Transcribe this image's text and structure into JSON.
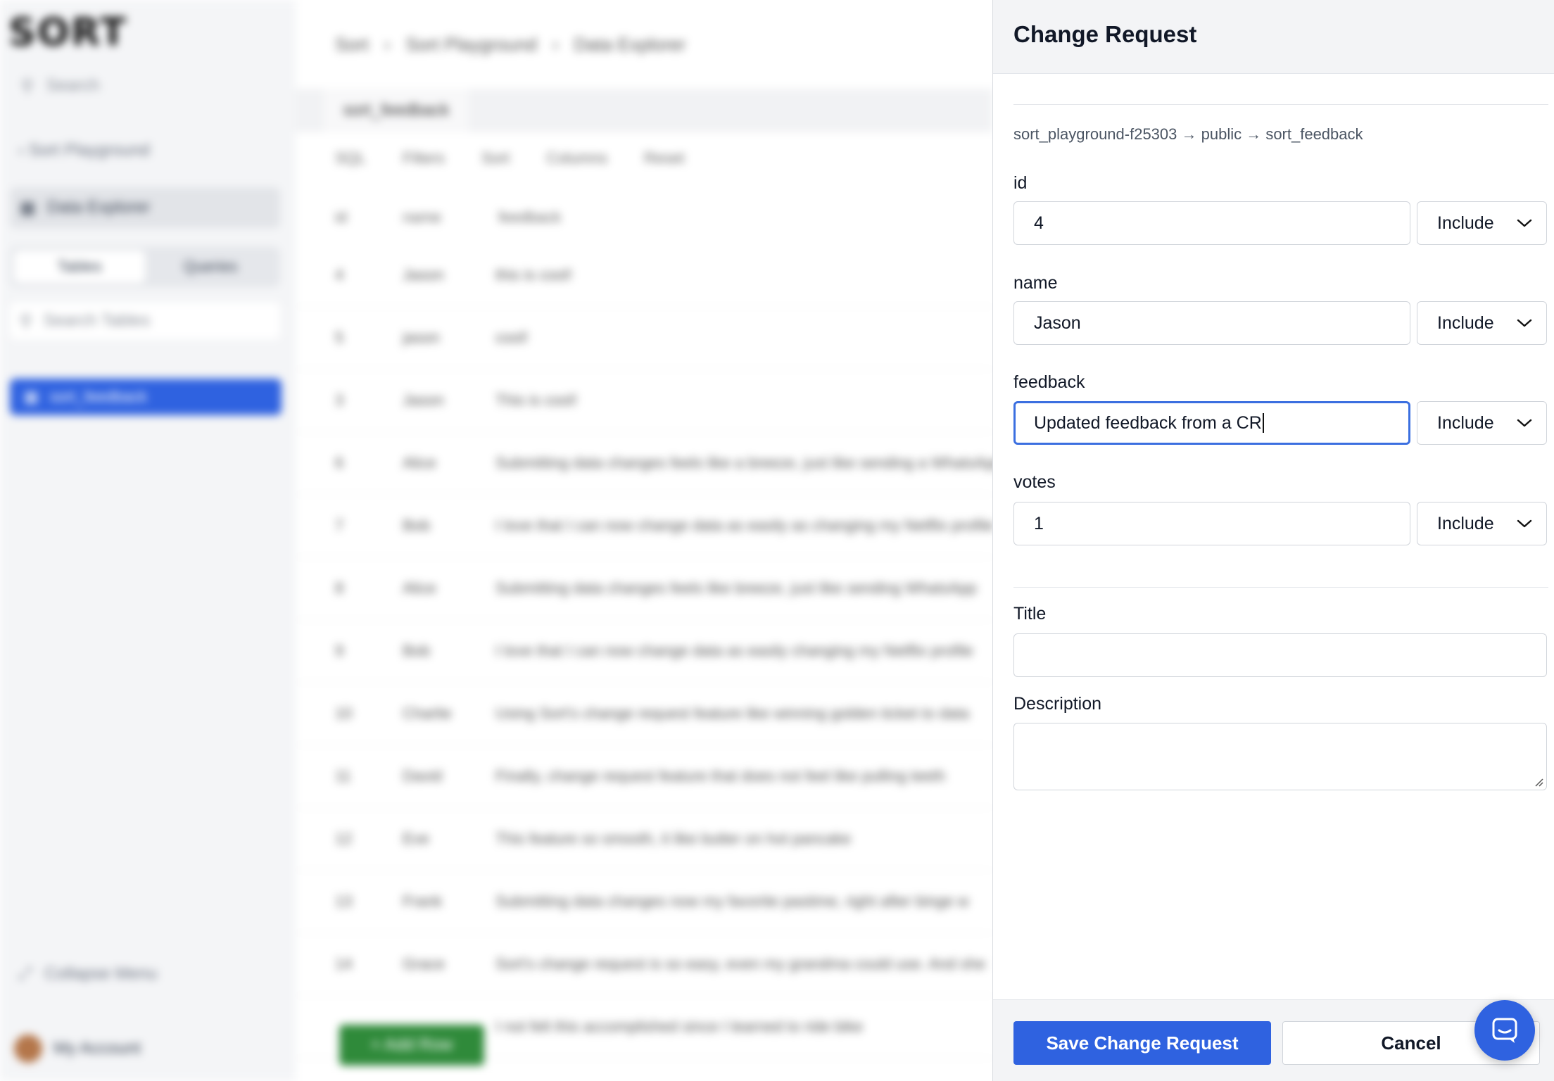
{
  "background": {
    "logo": "SORT",
    "search_placeholder": "Search",
    "back_link": "Sort Playground",
    "nav_item": "Data Explorer",
    "toggle": [
      "Tables",
      "Queries"
    ],
    "table_search_placeholder": "Search Tables",
    "selected_table": "sort_feedback",
    "collapse": "Collapse Menu",
    "account": "My Account",
    "breadcrumb": [
      "Sort",
      "Sort Playground",
      "Data Explorer"
    ],
    "tab": "sort_feedback",
    "toolbar": [
      "SQL",
      "Filters",
      "Sort",
      "Columns",
      "Reset"
    ],
    "columns": [
      "id",
      "name",
      "feedback"
    ],
    "rows": [
      {
        "id": "4",
        "name": "Jason",
        "feedback": "this is cool!"
      },
      {
        "id": "5",
        "name": "jason",
        "feedback": "cool!"
      },
      {
        "id": "3",
        "name": "Jason",
        "feedback": "This is cool!"
      },
      {
        "id": "6",
        "name": "Alice",
        "feedback": "Submitting data changes feels like a breeze, just like sending a WhatsApp"
      },
      {
        "id": "7",
        "name": "Bob",
        "feedback": "I love that I can now change data as easily as changing my Netflix profile"
      },
      {
        "id": "8",
        "name": "Alice",
        "feedback": "Submitting data changes feels like breeze, just like sending WhatsApp"
      },
      {
        "id": "9",
        "name": "Bob",
        "feedback": "I love that I can now change data as easily changing my Netflix profile"
      },
      {
        "id": "10",
        "name": "Charlie",
        "feedback": "Using Sort's change request feature like winning golden ticket to data"
      },
      {
        "id": "11",
        "name": "David",
        "feedback": "Finally, change request feature that does not feel like pulling teeth"
      },
      {
        "id": "12",
        "name": "Eve",
        "feedback": "This feature so smooth, it like butter on hot pancake"
      },
      {
        "id": "13",
        "name": "Frank",
        "feedback": "Submitting data changes now my favorite pastime, right after binge w"
      },
      {
        "id": "14",
        "name": "Grace",
        "feedback": "Sort's change request is so easy, even my grandma could use. And she"
      },
      {
        "id": "",
        "name": "",
        "feedback": "I not felt this accomplished since I learned to ride bike"
      }
    ],
    "add_row": "+ Add Row"
  },
  "panel": {
    "title": "Change Request",
    "path": "sort_playground-f25303 → public → sort_feedback",
    "fields": [
      {
        "label": "id",
        "value": "4",
        "mode": "Include"
      },
      {
        "label": "name",
        "value": "Jason",
        "mode": "Include"
      },
      {
        "label": "feedback",
        "value": "Updated feedback from a CR",
        "mode": "Include"
      },
      {
        "label": "votes",
        "value": "1",
        "mode": "Include"
      }
    ],
    "title_label": "Title",
    "title_value": "",
    "description_label": "Description",
    "description_value": "",
    "save_label": "Save Change Request",
    "cancel_label": "Cancel"
  },
  "colors": {
    "primary": "#2f62e0",
    "focus": "#3b6fe0",
    "panel_bg": "#f3f4f6"
  },
  "icons": [
    "search-icon",
    "chevron-left-icon",
    "data-explorer-icon",
    "table-icon",
    "collapse-icon",
    "chevron-down-icon",
    "resize-handle-icon",
    "chat-icon"
  ]
}
